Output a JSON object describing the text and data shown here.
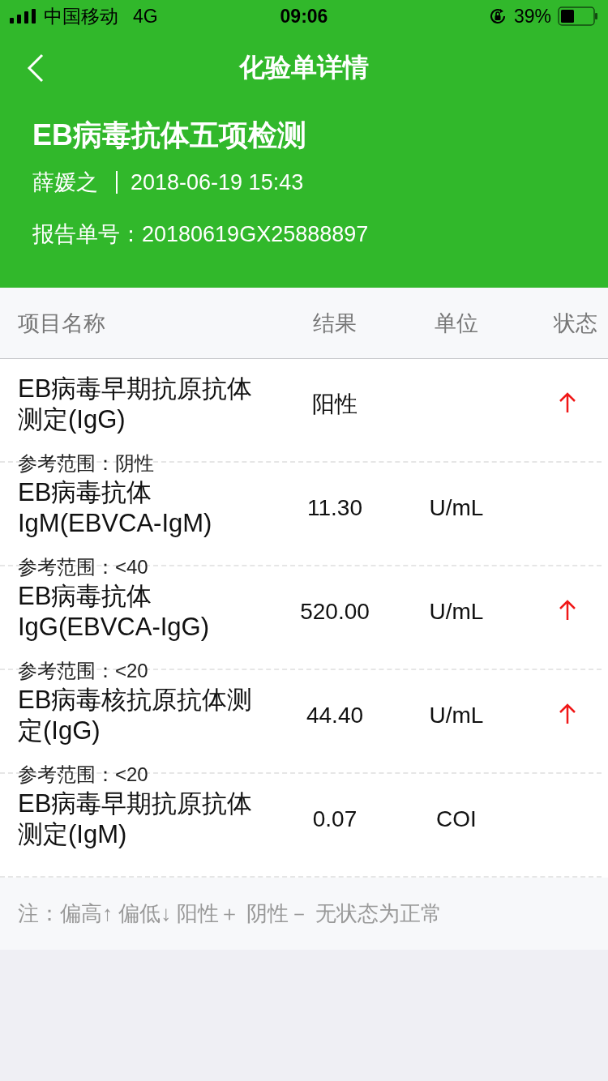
{
  "status_bar": {
    "carrier": "中国移动",
    "network": "4G",
    "time": "09:06",
    "battery": "39%"
  },
  "nav": {
    "title": "化验单详情"
  },
  "report": {
    "title": "EB病毒抗体五项检测",
    "patient": "薛媛之",
    "datetime": "2018-06-19 15:43",
    "number_label": "报告单号：",
    "number": "20180619GX25888897"
  },
  "table": {
    "columns": [
      "项目名称",
      "结果",
      "单位",
      "状态"
    ],
    "rows": [
      {
        "name": "EB病毒早期抗原抗体测定(IgG)",
        "result": "阳性",
        "reference": "参考范围：阴性",
        "elevated": true
      },
      {
        "name": "EB病毒抗体IgM(EBVCA-IgM)",
        "result": "11.30",
        "unit": "U/mL",
        "reference": "参考范围：<40",
        "elevated": false
      },
      {
        "name": "EB病毒抗体IgG(EBVCA-IgG)",
        "result": "520.00",
        "unit": "U/mL",
        "reference": "参考范围：<20",
        "elevated": true
      },
      {
        "name": "EB病毒核抗原抗体测定(IgG)",
        "result": "44.40",
        "unit": "U/mL",
        "reference": "参考范围：<20",
        "elevated": true
      },
      {
        "name": "EB病毒早期抗原抗体测定(IgM)",
        "result": "0.07",
        "unit": "COI",
        "elevated": false
      }
    ]
  },
  "note": "注：偏高↑ 偏低↓ 阳性＋ 阴性－ 无状态为正常"
}
